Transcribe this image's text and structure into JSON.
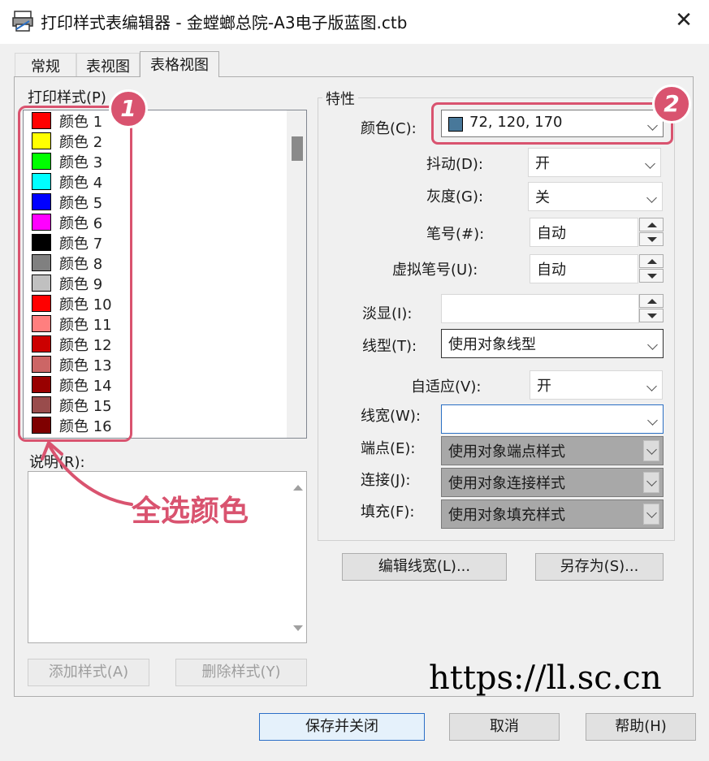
{
  "window": {
    "title": "打印样式表编辑器 - 金螳螂总院-A3电子版蓝图.ctb",
    "close": "✕"
  },
  "tabs": [
    "常规",
    "表视图",
    "表格视图"
  ],
  "left": {
    "list_label": "打印样式(P)",
    "items": [
      {
        "label": "颜色  1",
        "color": "#ff0000"
      },
      {
        "label": "颜色  2",
        "color": "#ffff00"
      },
      {
        "label": "颜色  3",
        "color": "#00ff00"
      },
      {
        "label": "颜色  4",
        "color": "#00ffff"
      },
      {
        "label": "颜色  5",
        "color": "#0000ff"
      },
      {
        "label": "颜色  6",
        "color": "#ff00ff"
      },
      {
        "label": "颜色  7",
        "color": "#000000"
      },
      {
        "label": "颜色  8",
        "color": "#808080"
      },
      {
        "label": "颜色  9",
        "color": "#c0c0c0"
      },
      {
        "label": "颜色  10",
        "color": "#ff0000"
      },
      {
        "label": "颜色  11",
        "color": "#ff7f7f"
      },
      {
        "label": "颜色  12",
        "color": "#cc0000"
      },
      {
        "label": "颜色  13",
        "color": "#cc6666"
      },
      {
        "label": "颜色  14",
        "color": "#990000"
      },
      {
        "label": "颜色  15",
        "color": "#994c4c"
      },
      {
        "label": "颜色  16",
        "color": "#7f0000"
      }
    ],
    "desc_label": "说明(R):",
    "add_button": "添加样式(A)",
    "delete_button": "删除样式(Y)"
  },
  "properties": {
    "group_title": "特性",
    "color_label": "颜色(C):",
    "color_value": "72, 120, 170",
    "color_swatch": "#48789a",
    "dither_label": "抖动(D):",
    "dither_value": "开",
    "gray_label": "灰度(G):",
    "gray_value": "关",
    "pen_label": "笔号(#):",
    "pen_value": "自动",
    "vpen_label": "虚拟笔号(U):",
    "vpen_value": "自动",
    "screen_label": "淡显(I):",
    "screen_value": "",
    "linetype_label": "线型(T):",
    "linetype_value": "使用对象线型",
    "adaptive_label": "自适应(V):",
    "adaptive_value": "开",
    "lineweight_label": "线宽(W):",
    "lineweight_value": "",
    "endstyle_label": "端点(E):",
    "endstyle_value": "使用对象端点样式",
    "joinstyle_label": "连接(J):",
    "joinstyle_value": "使用对象连接样式",
    "fillstyle_label": "填充(F):",
    "fillstyle_value": "使用对象填充样式",
    "edit_lineweight_button": "编辑线宽(L)...",
    "save_as_button": "另存为(S)..."
  },
  "footer": {
    "save_close": "保存并关闭",
    "cancel": "取消",
    "help": "帮助(H)"
  },
  "annotations": {
    "badge1": "1",
    "badge2": "2",
    "note": "全选颜色",
    "accent": "#d9536f"
  },
  "watermark": "https://ll.sc.cn"
}
